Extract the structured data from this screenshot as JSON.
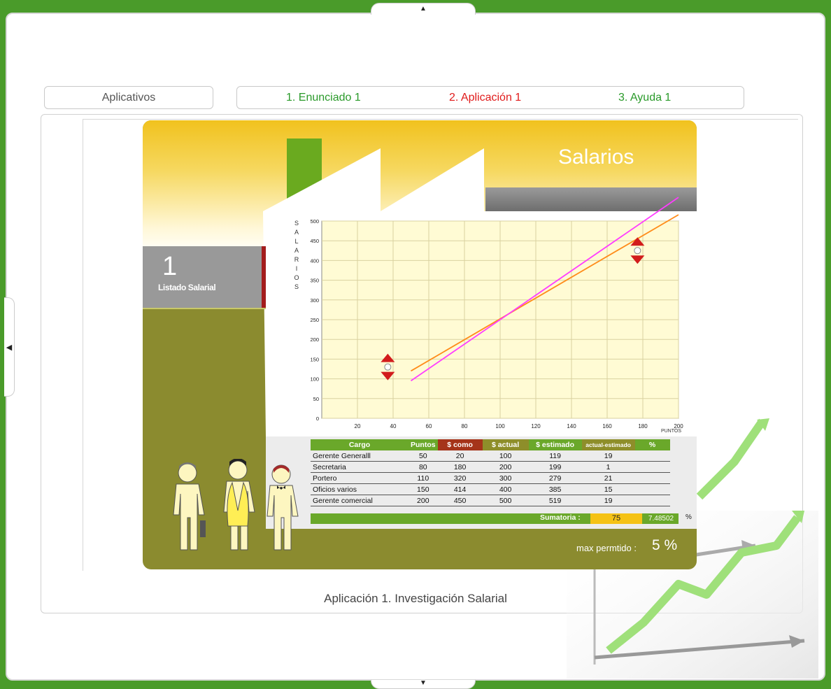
{
  "tabs": {
    "aplicativos": "Aplicativos",
    "enunciado": "1. Enunciado 1",
    "aplicacion": "2. Aplicación 1",
    "ayuda": "3. Ayuda 1"
  },
  "colors": {
    "enunciado": "#2a9a2a",
    "aplicacion": "#e01b1b",
    "ayuda": "#2a9a2a"
  },
  "caption": "Aplicación 1. Investigación Salarial",
  "applet": {
    "title": "Salarios",
    "side_number": "1",
    "side_label": "Listado Salarial",
    "y_axis_letters": [
      "S",
      "A",
      "L",
      "A",
      "R",
      "I",
      "O",
      "S"
    ],
    "x_axis_label": "PUNTOS",
    "table": {
      "headers": [
        "Cargo",
        "Puntos",
        "$ como",
        "$ actual",
        "$ estimado",
        "actual-estimado",
        "%"
      ],
      "rows": [
        [
          "Gerente Generalll",
          "50",
          "20",
          "100",
          "119",
          "19"
        ],
        [
          "Secretaria",
          "80",
          "180",
          "200",
          "199",
          "1"
        ],
        [
          "Portero",
          "110",
          "320",
          "300",
          "279",
          "21"
        ],
        [
          "Oficios varios",
          "150",
          "414",
          "400",
          "385",
          "15"
        ],
        [
          "Gerente comercial",
          "200",
          "450",
          "500",
          "519",
          "19"
        ]
      ],
      "sum_label": "Sumatoria :",
      "sum_value": "75",
      "sum_pct": "7.48502",
      "pct_sign": "%"
    },
    "max_label": "max permtido :",
    "max_value": "5 %"
  },
  "chart_data": {
    "type": "line",
    "xlim": [
      0,
      200
    ],
    "ylim": [
      0,
      500
    ],
    "x_ticks": [
      20,
      40,
      60,
      80,
      100,
      120,
      140,
      160,
      180,
      200
    ],
    "y_ticks": [
      0,
      50,
      100,
      150,
      200,
      250,
      300,
      350,
      400,
      450,
      500
    ],
    "series": [
      {
        "color": "#ff8c1a",
        "x": [
          50,
          200
        ],
        "y": [
          120,
          516
        ]
      },
      {
        "color": "#ff3cff",
        "x": [
          50,
          200
        ],
        "y": [
          95,
          560
        ]
      }
    ],
    "markers": [
      {
        "x": 37,
        "y": 130
      },
      {
        "x": 177,
        "y": 425
      }
    ]
  }
}
